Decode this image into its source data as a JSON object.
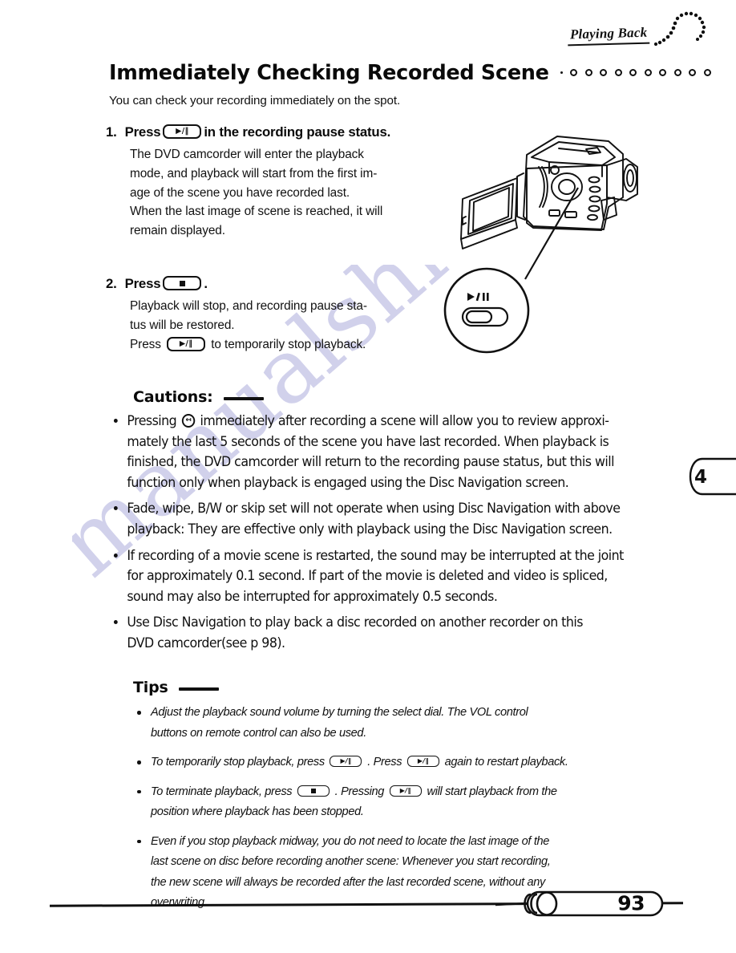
{
  "header": {
    "section_tag": "Playing Back",
    "arc_icon": "dotted-arc-icon"
  },
  "title": {
    "heading": "Immediately Checking Recorded Scene",
    "dot_count": 10,
    "lede": "You can check your recording immediately on the spot."
  },
  "steps": [
    {
      "number": "1.",
      "head_before": "Press",
      "head_key": "▶/‖",
      "head_after": "in the recording pause status.",
      "body_lines": [
        "The DVD camcorder will enter the playback",
        "mode, and playback will start from the first im-",
        "age of the scene you have recorded last.",
        "When the last image of scene is reached, it will",
        "remain displayed."
      ]
    },
    {
      "number": "2.",
      "head_before": "Press",
      "head_key": "■",
      "head_after": ".",
      "body_lines": [
        "Playback will stop, and recording pause sta-",
        "tus will be restored."
      ],
      "body_last_before": "Press",
      "body_last_key": "▶/‖",
      "body_last_after": "to temporarily stop playback."
    }
  ],
  "cautions": {
    "heading": "Cautions:",
    "items": [
      {
        "lead": "Pressing",
        "icon": "review-rewind-icon",
        "lines": [
          "immediately after recording a scene will allow you to review approxi-",
          "mately the last 5 seconds of the scene you have last recorded. When playback is",
          "finished, the DVD camcorder will return to the recording pause status, but this will",
          "function only when playback is engaged using the Disc Navigation screen."
        ]
      },
      {
        "lines": [
          "Fade, wipe, B/W or skip set will not operate when using Disc Navigation with above",
          "playback: They are effective only with playback using the Disc Navigation screen."
        ]
      },
      {
        "lines": [
          "If recording of a movie scene is restarted, the sound may be interrupted at the joint",
          "for approximately 0.1 second. If part of the movie is deleted and video is spliced,",
          "sound may also be interrupted for approximately 0.5 seconds."
        ]
      },
      {
        "lines": [
          "Use Disc Navigation to play back a disc recorded on another recorder on this",
          "DVD camcorder(see p 98)."
        ]
      }
    ]
  },
  "tips": {
    "heading": "Tips",
    "items": [
      {
        "lines": [
          "Adjust the playback sound volume by turning the select dial. The VOL control",
          "buttons on remote control can also be used."
        ]
      },
      {
        "segmented": true,
        "seg": {
          "a": "To temporarily stop playback, press",
          "key1": "▶/‖",
          "b": ". Press",
          "key2": "▶/‖",
          "c": "again to restart playback."
        }
      },
      {
        "segmented": true,
        "seg": {
          "a": "To terminate playback, press",
          "key1": "■",
          "b": ". Pressing",
          "key2": "▶/‖",
          "c": "will start playback from the"
        },
        "lines": [
          "position where playback has been stopped."
        ]
      },
      {
        "lines": [
          "Even if you stop playback midway, you do not need to locate the last image of the",
          "last scene on disc before recording another scene: Whenever you start recording,",
          "the new scene will always be recorded after the last recorded scene, without any",
          "overwriting."
        ]
      }
    ]
  },
  "illustration": {
    "name": "dvd-camcorder-illustration",
    "callout_button_label": "▶/‖"
  },
  "chapter_tab": {
    "number": "4"
  },
  "footer": {
    "page_number": "93"
  },
  "watermark": {
    "text": "manualshive.com"
  },
  "colors": {
    "ink": "#0a0a0a",
    "paper": "#ffffff",
    "watermark": "#c9c9e8"
  }
}
